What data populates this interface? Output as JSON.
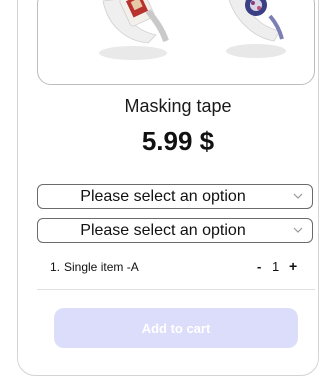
{
  "product": {
    "title": "Masking tape",
    "price": "5.99 $"
  },
  "options": [
    {
      "value": "Please select an option",
      "icon": "chevron-down-icon"
    },
    {
      "value": "Please select an option",
      "icon": "chevron-down-icon"
    }
  ],
  "quantity_row": {
    "index": "1.",
    "item": "Single item -A",
    "minus": "-",
    "count": "1",
    "plus": "+"
  },
  "cart": {
    "add_label": "Add to cart"
  },
  "colors": {
    "button_disabled_bg": "#dcdcfb",
    "button_text": "#ffffff",
    "border": "#6b6b6b"
  }
}
